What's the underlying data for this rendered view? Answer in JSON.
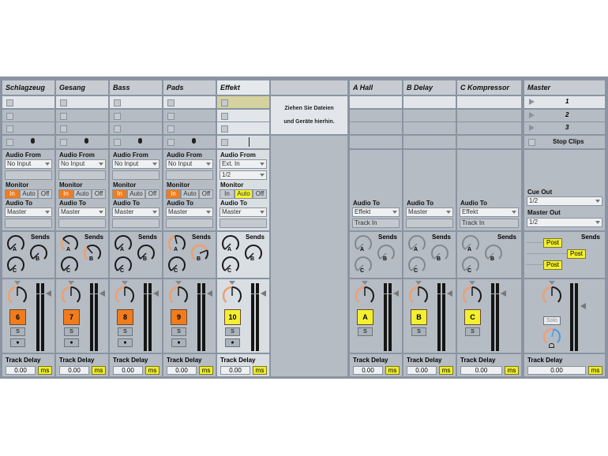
{
  "tracks": [
    {
      "name": "Schlagzeug",
      "audio_from": "No Input",
      "monitor_active": "In",
      "audio_to": "Master",
      "number": "6",
      "color": "#f07c1e",
      "sendA": 0.0,
      "sendB": 0.0,
      "sendC": 0.0
    },
    {
      "name": "Gesang",
      "audio_from": "No Input",
      "monitor_active": "In",
      "audio_to": "Master",
      "number": "7",
      "color": "#f07c1e",
      "sendA": 0.3,
      "sendB": 0.35,
      "sendC": 0.0
    },
    {
      "name": "Bass",
      "audio_from": "No Input",
      "monitor_active": "In",
      "audio_to": "Master",
      "number": "8",
      "color": "#f07c1e",
      "sendA": 0.0,
      "sendB": 0.0,
      "sendC": 0.0
    },
    {
      "name": "Pads",
      "audio_from": "No Input",
      "monitor_active": "In",
      "audio_to": "Master",
      "number": "9",
      "color": "#f07c1e",
      "sendA": 0.45,
      "sendB": 0.75,
      "sendC": 0.0
    },
    {
      "name": "Effekt",
      "audio_from": "Ext. In",
      "channel": "1/2",
      "monitor_active": "Auto",
      "audio_to": "Master",
      "number": "10",
      "color": "#f4f030",
      "sendA": 0.0,
      "sendB": 0.0,
      "sendC": 0.0,
      "selected": true
    }
  ],
  "monitor_labels": [
    "In",
    "Auto",
    "Off"
  ],
  "labels": {
    "audio_from": "Audio From",
    "monitor": "Monitor",
    "audio_to": "Audio To",
    "sends": "Sends",
    "track_delay": "Track Delay",
    "ms": "ms",
    "solo": "S",
    "rec": "●",
    "send_a": "A",
    "send_b": "B",
    "send_c": "C"
  },
  "drop_zone": {
    "line1": "Ziehen Sie Dateien",
    "line2": "und Geräte hierhin."
  },
  "returns": [
    {
      "name": "A Hall",
      "audio_to": "Effekt",
      "sub": "Track In",
      "letter": "A"
    },
    {
      "name": "B Delay",
      "audio_to": "Master",
      "sub": "",
      "letter": "B"
    },
    {
      "name": "C Kompressor",
      "audio_to": "Effekt",
      "sub": "Track In",
      "letter": "C"
    }
  ],
  "master": {
    "name": "Master",
    "scenes": [
      "1",
      "2",
      "3"
    ],
    "stop_clips": "Stop Clips",
    "cue_out_label": "Cue Out",
    "cue_out": "1/2",
    "master_out_label": "Master Out",
    "master_out": "1/2",
    "post": "Post",
    "solo": "Solo"
  },
  "track_delay_value": "0.00",
  "colors": {
    "orange": "#f07c1e",
    "yellow": "#f4f030",
    "panel": "#b5bcc4"
  }
}
